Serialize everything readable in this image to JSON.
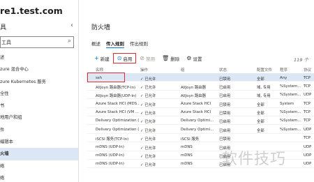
{
  "left": {
    "hostname": "re1.test.com",
    "tools_title": "具",
    "search_text": "工具",
    "nav_items": [
      "述",
      "zure 混合中心",
      "zure Kubernetes 服务",
      "全性",
      "书",
      "地用户和组",
      "件",
      "编辑本",
      "火墙",
      "络",
      "络"
    ],
    "selected_index": 8
  },
  "main": {
    "title": "防火墙",
    "tabs": [
      "概述",
      "传入规则",
      "传出规则"
    ],
    "active_tab": 1,
    "toolbar": {
      "new": "新建",
      "enable": "启用",
      "disable": "禁用",
      "delete": "删除",
      "settings": "设置"
    },
    "count": "119 个",
    "columns": {
      "name": "名称",
      "action": "操作",
      "group": "组",
      "status": "状态",
      "profile": "配置文件",
      "program": "程序",
      "protocol": "协议"
    },
    "rows": [
      {
        "name": "ssh",
        "action": "已允许",
        "group": "",
        "status": "已禁用",
        "profile": "全部",
        "program": "Any",
        "protocol": "TCP"
      },
      {
        "name": "AllJoyn 路由器(TCP-In)",
        "action": "已允许",
        "group": "AllJoyn 路由器",
        "status": "已启用",
        "profile": "域, 专用",
        "program": "%System...",
        "protocol": "TCP"
      },
      {
        "name": "AllJoyn 路由器(UDP-In)",
        "action": "已允许",
        "group": "AllJoyn 路由器",
        "status": "已启用",
        "profile": "域, 专用",
        "program": "%System...",
        "protocol": "UDP"
      },
      {
        "name": "Azure Stack HCI (MDS ...",
        "action": "已允许",
        "group": "Azure Stack HCI",
        "status": "已禁用",
        "profile": "全部",
        "program": "System",
        "protocol": "TCP"
      },
      {
        "name": "Azure Stack HCI (VM ...",
        "action": "已允许",
        "group": "Azure Stack HCI",
        "status": "已禁用",
        "profile": "全部",
        "program": "%System...",
        "protocol": "TCP"
      },
      {
        "name": "Delivery Optimization (...",
        "action": "已允许",
        "group": "Delivery Optimi...",
        "status": "已启用",
        "profile": "全部",
        "program": "%System...",
        "protocol": "TCP"
      },
      {
        "name": "Delivery Optimization (...",
        "action": "已允许",
        "group": "Delivery Optimi...",
        "status": "已启用",
        "profile": "全部",
        "program": "%System...",
        "protocol": "UDP"
      },
      {
        "name": "iSCSI 服务(TCP-In)",
        "action": "已允许",
        "group": "iSCSI 服务",
        "status": "已禁用",
        "profile": "",
        "program": "",
        "protocol": "TCP"
      },
      {
        "name": "mDNS (UDP-In)",
        "action": "已允许",
        "group": "mDNS",
        "status": "已启用",
        "profile": "",
        "program": "",
        "protocol": "UDP"
      },
      {
        "name": "mDNS (UDP-In)",
        "action": "已允许",
        "group": "mDNS",
        "status": "已启用",
        "profile": "",
        "program": "",
        "protocol": "UDP"
      },
      {
        "name": "mDNS (UDP-In)",
        "action": "已允许",
        "group": "mDNS",
        "status": "已启用",
        "profile": "",
        "program": "",
        "protocol": "UDP"
      }
    ],
    "selected_row": 0
  },
  "watermark": "软件技巧",
  "colors": {
    "accent": "#0078d4",
    "highlight": "#e0282a",
    "selected": "#dbe7f5"
  }
}
